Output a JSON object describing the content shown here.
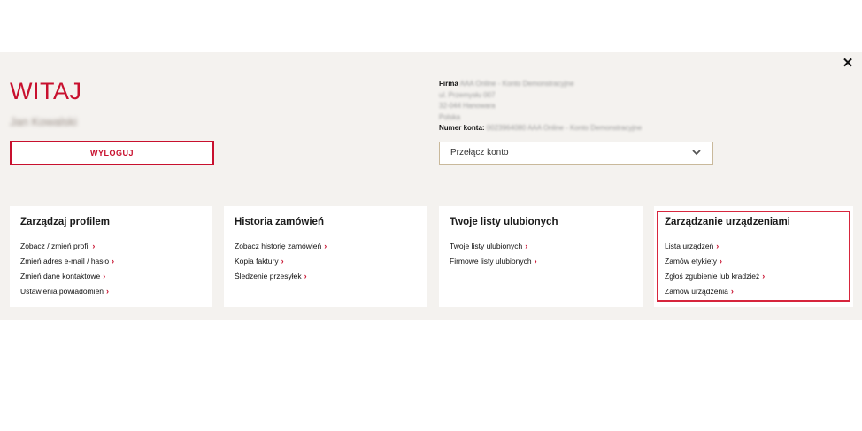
{
  "header": {
    "welcome": "WITAJ",
    "user_name": "Jan Kowalski",
    "logout_label": "WYLOGUJ",
    "close_icon": "close-icon"
  },
  "account": {
    "company_label": "Firma",
    "company_value": "AAA Online - Konto Demonstracyjne",
    "address_lines": [
      "ul. Przemysłu 007",
      "32-044 Hanowara",
      "Polska"
    ],
    "account_number_label": "Numer konta:",
    "account_number_value": "0023964080 AAA Online - Konto Demonstracyjne",
    "switch_label": "Przełącz konto"
  },
  "cards": [
    {
      "title": "Zarządzaj profilem",
      "links": [
        "Zobacz / zmień profil",
        "Zmień adres e-mail / hasło",
        "Zmień dane kontaktowe",
        "Ustawienia powiadomień"
      ]
    },
    {
      "title": "Historia zamówień",
      "links": [
        "Zobacz historię zamówień",
        "Kopia faktury",
        "Śledzenie przesyłek"
      ]
    },
    {
      "title": "Twoje listy ulubionych",
      "links": [
        "Twoje listy ulubionych",
        "Firmowe listy ulubionych"
      ]
    },
    {
      "title": "Zarządzanie urządzeniami",
      "links": [
        "Lista urządzeń",
        "Zamów etykiety",
        "Zgłoś zgubienie lub kradzież",
        "Zamów urządzenia"
      ]
    }
  ],
  "arrow": "›",
  "colors": {
    "accent": "#c8102e",
    "panel_bg": "#f4f2ef",
    "highlight": "#d7263d",
    "select_border": "#c9b99b"
  }
}
